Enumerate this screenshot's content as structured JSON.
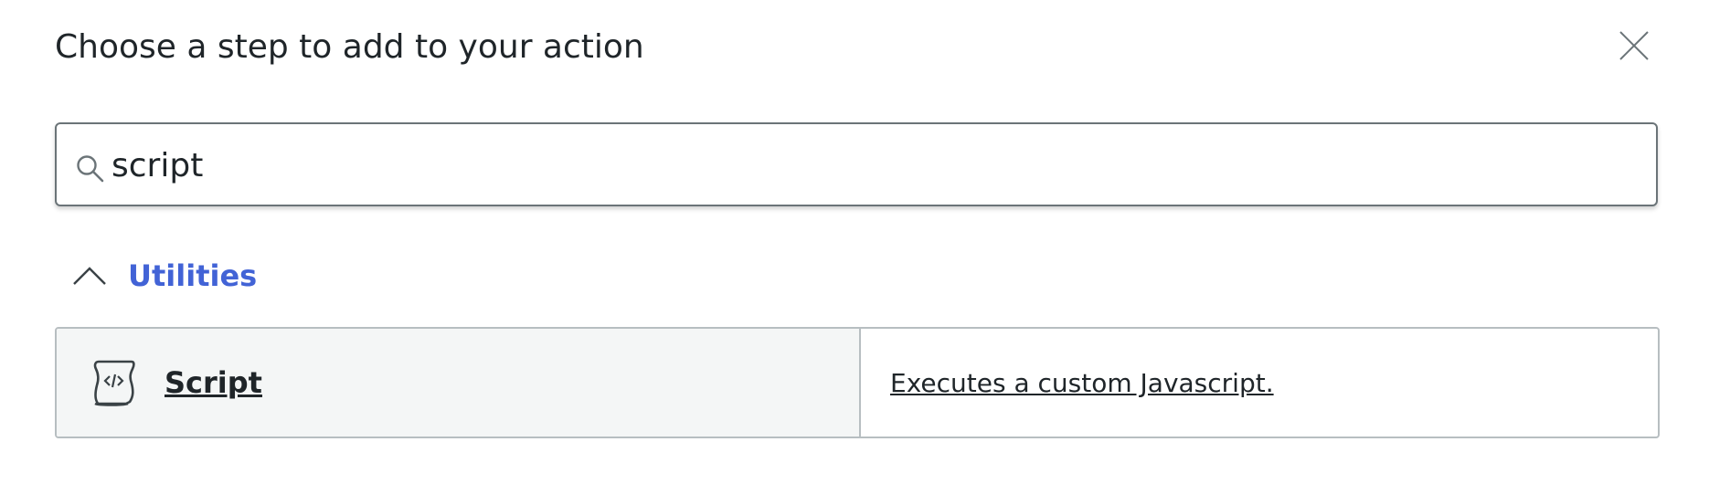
{
  "dialog": {
    "title": "Choose a step to add to your action",
    "close_icon": "close-icon"
  },
  "search": {
    "value": "script",
    "icon": "search-icon"
  },
  "group": {
    "label": "Utilities",
    "icon": "chevron-up-icon",
    "expanded": true,
    "accent_color": "#4263d6"
  },
  "results": [
    {
      "name": "Script",
      "description": "Executes a custom Javascript.",
      "icon": "script-scroll-icon"
    }
  ]
}
